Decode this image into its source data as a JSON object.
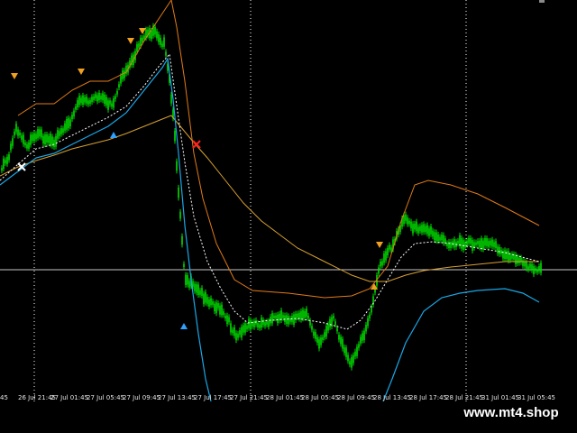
{
  "x_axis": {
    "ticks": [
      "45",
      "26 Jul 21:45",
      "27 Jul 01:45",
      "27 Jul 05:45",
      "27 Jul 09:45",
      "27 Jul 13:45",
      "27 Jul 17:45",
      "27 Jul 21:45",
      "28 Jul 01:45",
      "28 Jul 05:45",
      "28 Jul 09:45",
      "28 Jul 13:45",
      "28 Jul 17:45",
      "28 Jul 21:45",
      "31 Jul 01:45",
      "31 Jul 05:45"
    ]
  },
  "watermark": "www.mt4.shop",
  "colors": {
    "background": "#000000",
    "candles": "#00e000",
    "upper_band": "#e07a18",
    "lower_band": "#1aa7e6",
    "slow_ma": "#d6a030",
    "fast_ma": "#ffffff",
    "grid": "#ffffff",
    "arrow_orange": "#f0a020",
    "arrow_blue": "#30a0ff",
    "cross_red": "#ff2020",
    "cross_white": "#ffffff"
  }
}
